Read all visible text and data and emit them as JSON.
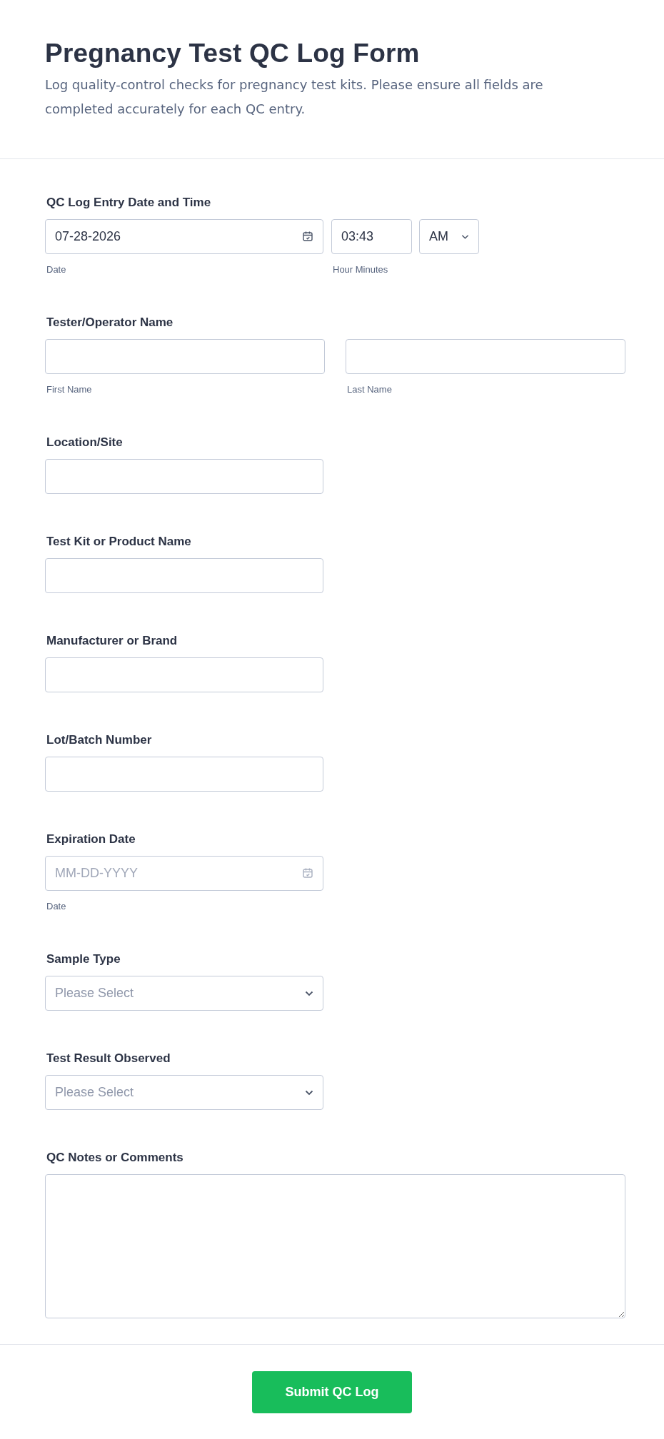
{
  "header": {
    "title": "Pregnancy Test QC Log Form",
    "description": "Log quality-control checks for pregnancy test kits. Please ensure all fields are completed accurately for each QC entry."
  },
  "fields": [
    {
      "kind": "datetime",
      "label": "QC Log Entry Date and Time",
      "date": {
        "value": "07-28-2026",
        "sublabel": "Date"
      },
      "time": {
        "value": "03:43",
        "sublabel": "Hour Minutes"
      },
      "ampm": "AM"
    },
    {
      "kind": "name",
      "label": "Tester/Operator Name",
      "parts": [
        {
          "sublabel": "First Name"
        },
        {
          "sublabel": "Last Name"
        }
      ]
    },
    {
      "kind": "text",
      "label": "Location/Site"
    },
    {
      "kind": "text",
      "label": "Test Kit or Product Name"
    },
    {
      "kind": "text",
      "label": "Manufacturer or Brand"
    },
    {
      "kind": "text",
      "label": "Lot/Batch Number"
    },
    {
      "kind": "date",
      "label": "Expiration Date",
      "placeholder": "MM-DD-YYYY",
      "sublabel": "Date"
    },
    {
      "kind": "select",
      "label": "Sample Type",
      "placeholder": "Please Select"
    },
    {
      "kind": "select",
      "label": "Test Result Observed",
      "placeholder": "Please Select"
    },
    {
      "kind": "textarea",
      "label": "QC Notes or Comments"
    }
  ],
  "submit": "Submit QC Log"
}
